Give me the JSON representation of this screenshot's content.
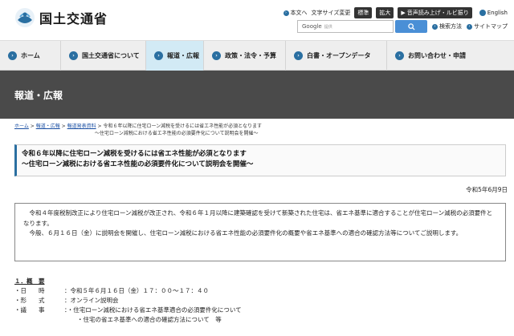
{
  "header": {
    "logo_text": "国土交通省",
    "utility": {
      "body_text": "本文へ",
      "font_size_label": "文字サイズ変更",
      "font_standard": "標準",
      "font_large": "拡大",
      "voice_button": "音声読み上げ・ルビ振り",
      "english": "English",
      "search_engine": "Google",
      "search_placeholder": "提供",
      "search_method": "検索方法",
      "sitemap": "サイトマップ"
    }
  },
  "nav": {
    "items": [
      {
        "label": "ホーム"
      },
      {
        "label": "国土交通省について"
      },
      {
        "label": "報道・広報"
      },
      {
        "label": "政策・法令・予算"
      },
      {
        "label": "白書・オープンデータ"
      },
      {
        "label": "お問い合わせ・申請"
      }
    ]
  },
  "banner": {
    "title": "報道・広報"
  },
  "breadcrumb": {
    "home": "ホーム",
    "press": "報道・広報",
    "releases": "報道発表資料",
    "sep": ">",
    "current_line1": "令和６年以降に住宅ローン減税を受けるには省エネ性能が必須となります",
    "current_line2": "～住宅ローン減税における省エネ性能の必須要件化について説明会を開催～"
  },
  "article": {
    "title_line1": "令和６年以降に住宅ローン減税を受けるには省エネ性能が必須となります",
    "title_line2": "～住宅ローン減税における省エネ性能の必須要件化について説明会を開催～",
    "date": "令和5年6月9日",
    "summary_p1": "令和４年度税制改正により住宅ローン減税が改正され、令和６年１月以降に建築確認を受けて新築された住宅は、省エネ基準に適合することが住宅ローン減税の必須要件となります。",
    "summary_p2": "今般、６月１６日（金）に説明会を開催し、住宅ローン減税における省エネ性能の必須要件化の概要や省エネ基準への適合の確認方法等についてご説明します。",
    "section1_num": "１．",
    "section1_title": "概　要",
    "rows": [
      {
        "label": "・日　　時",
        "value": "：令和５年６月１６日（金）１７：００～１７：４０"
      },
      {
        "label": "・形　　式",
        "value": "：オンライン説明会"
      },
      {
        "label": "・議　　事",
        "value": "：・住宅ローン減税における省エネ基準適合の必須要件化について"
      }
    ],
    "row_continuation": "・住宅の省エネ基準への適合の確認方法について　等"
  },
  "colors": {
    "accent": "#2a6fa1",
    "banner_bg": "#4a4a4a",
    "nav_active": "#d2eaf5",
    "nav_bg": "#eeeeee",
    "search_button": "#4a8fd6"
  }
}
